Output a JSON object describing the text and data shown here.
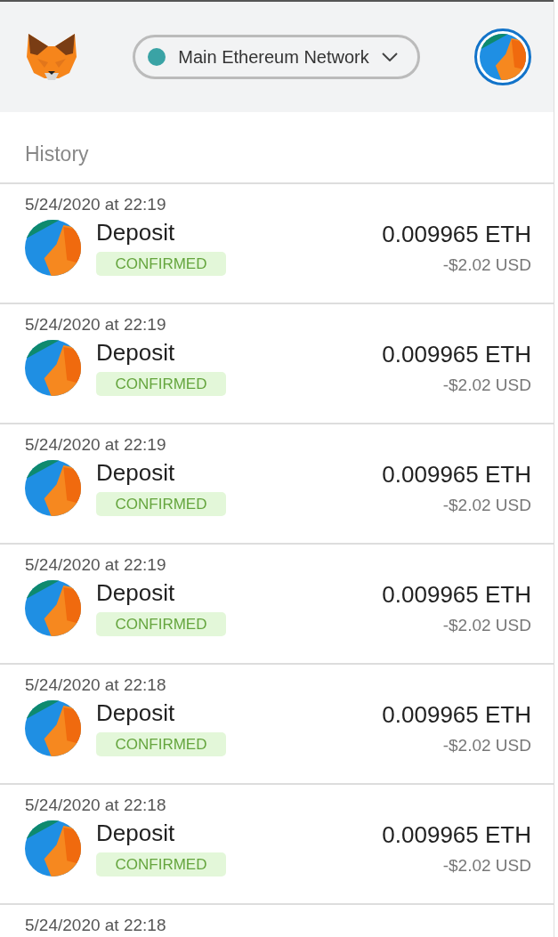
{
  "header": {
    "network": {
      "label": "Main Ethereum Network",
      "color": "#3aa3a5"
    }
  },
  "history": {
    "title": "History",
    "transactions": [
      {
        "date": "5/24/2020 at 22:19",
        "title": "Deposit",
        "status": "CONFIRMED",
        "kind": "confirmed",
        "amount": "0.009965 ETH",
        "fiat": "-$2.02 USD"
      },
      {
        "date": "5/24/2020 at 22:19",
        "title": "Deposit",
        "status": "CONFIRMED",
        "kind": "confirmed",
        "amount": "0.009965 ETH",
        "fiat": "-$2.02 USD"
      },
      {
        "date": "5/24/2020 at 22:19",
        "title": "Deposit",
        "status": "CONFIRMED",
        "kind": "confirmed",
        "amount": "0.009965 ETH",
        "fiat": "-$2.02 USD"
      },
      {
        "date": "5/24/2020 at 22:19",
        "title": "Deposit",
        "status": "CONFIRMED",
        "kind": "confirmed",
        "amount": "0.009965 ETH",
        "fiat": "-$2.02 USD"
      },
      {
        "date": "5/24/2020 at 22:18",
        "title": "Deposit",
        "status": "CONFIRMED",
        "kind": "confirmed",
        "amount": "0.009965 ETH",
        "fiat": "-$2.02 USD"
      },
      {
        "date": "5/24/2020 at 22:18",
        "title": "Deposit",
        "status": "CONFIRMED",
        "kind": "confirmed",
        "amount": "0.009965 ETH",
        "fiat": "-$2.02 USD"
      },
      {
        "date": "5/24/2020 at 22:18"
      }
    ]
  }
}
